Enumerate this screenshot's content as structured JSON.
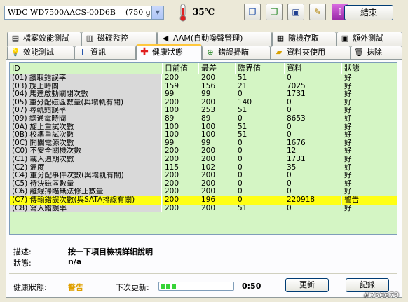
{
  "drive": {
    "name": "WDC WD7500AACS-00D6B",
    "size": "(750 gB)"
  },
  "temperature": "35℃",
  "toolbar": {
    "exit_label": "結束"
  },
  "tabs_row1": [
    {
      "label": "檔案效能測試",
      "icon": "file-icon"
    },
    {
      "label": "磁碟監控",
      "icon": "monitor-icon"
    },
    {
      "label": "AAM(自動噪聲管理)",
      "icon": "speaker-icon"
    },
    {
      "label": "隨機存取",
      "icon": "random-access-icon"
    },
    {
      "label": "額外測試",
      "icon": "extra-test-icon"
    }
  ],
  "tabs_row2": [
    {
      "label": "效能測試",
      "icon": "benchmark-icon"
    },
    {
      "label": "資訊",
      "icon": "info-icon"
    },
    {
      "label": "健康狀態",
      "icon": "health-cross-icon"
    },
    {
      "label": "錯誤掃瞄",
      "icon": "error-scan-icon"
    },
    {
      "label": "資料夾使用",
      "icon": "folder-icon"
    },
    {
      "label": "抹除",
      "icon": "trash-icon"
    }
  ],
  "table": {
    "headers": [
      "ID",
      "目前值",
      "最差",
      "臨界值",
      "資料",
      "狀態"
    ],
    "rows": [
      [
        "(01) 讀取錯誤率",
        "200",
        "200",
        "51",
        "0",
        "好"
      ],
      [
        "(03) 旋上時間",
        "159",
        "156",
        "21",
        "7025",
        "好"
      ],
      [
        "(04) 馬達啟動關閉次數",
        "99",
        "99",
        "0",
        "1731",
        "好"
      ],
      [
        "(05) 重分配磁區數量(與壞軌有關)",
        "200",
        "200",
        "140",
        "0",
        "好"
      ],
      [
        "(07) 尋軌錯誤率",
        "100",
        "253",
        "51",
        "0",
        "好"
      ],
      [
        "(09) 總通電時間",
        "89",
        "89",
        "0",
        "8653",
        "好"
      ],
      [
        "(0A) 旋上重試次數",
        "100",
        "100",
        "51",
        "0",
        "好"
      ],
      [
        "(0B) 校準重試次數",
        "100",
        "100",
        "51",
        "0",
        "好"
      ],
      [
        "(0C) 開關電源次數",
        "99",
        "99",
        "0",
        "1676",
        "好"
      ],
      [
        "(C0) 不安全關機次數",
        "200",
        "200",
        "0",
        "12",
        "好"
      ],
      [
        "(C1) 載入週期次數",
        "200",
        "200",
        "0",
        "1731",
        "好"
      ],
      [
        "(C2) 溫度",
        "115",
        "102",
        "0",
        "35",
        "好"
      ],
      [
        "(C4) 重分配事件次數(與壞軌有關)",
        "200",
        "200",
        "0",
        "0",
        "好"
      ],
      [
        "(C5) 待決磁區數量",
        "200",
        "200",
        "0",
        "0",
        "好"
      ],
      [
        "(C6) 離線掃瞄無法修正數量",
        "200",
        "200",
        "0",
        "0",
        "好"
      ],
      [
        "(C7) 傳輸錯誤次數(與SATA排線有關)",
        "200",
        "196",
        "0",
        "220918",
        "警告"
      ],
      [
        "(C8) 寫入錯誤率",
        "200",
        "200",
        "51",
        "0",
        "好"
      ]
    ]
  },
  "details": {
    "desc_label": "描述:",
    "desc_value": "按一下項目檢視詳細說明",
    "status_label": "狀態:",
    "status_value": "n/a"
  },
  "footer": {
    "health_label": "健康狀態:",
    "health_value": "警告",
    "next_update_label": "下次更新:",
    "progress_fraction": 0.22,
    "timer": "0:50",
    "update_button": "更新",
    "log_button": "記錄"
  },
  "watermark": "#750679"
}
